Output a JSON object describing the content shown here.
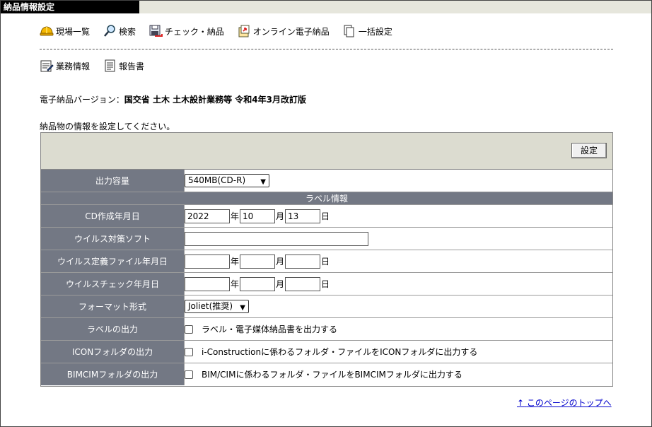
{
  "window": {
    "title": "納品情報設定"
  },
  "toolbar": {
    "row1": [
      {
        "label": "現場一覧",
        "icon": "helmet-icon"
      },
      {
        "label": "検索",
        "icon": "magnifier-icon"
      },
      {
        "label": "チェック・納品",
        "icon": "floppy-check-icon"
      },
      {
        "label": "オンライン電子納品",
        "icon": "online-delivery-icon"
      },
      {
        "label": "一括設定",
        "icon": "documents-icon"
      }
    ],
    "row2": [
      {
        "label": "業務情報",
        "icon": "business-info-icon"
      },
      {
        "label": "報告書",
        "icon": "report-icon"
      }
    ]
  },
  "version": {
    "prefix": "電子納品バージョン：",
    "value": "国交省 土木 土木設計業務等 令和4年3月改訂版"
  },
  "instruction": "納品物の情報を設定してください。",
  "form": {
    "set_button": "設定",
    "output_capacity": {
      "label": "出力容量",
      "value": "540MB(CD-R)"
    },
    "label_section": "ラベル情報",
    "cd_date": {
      "label": "CD作成年月日",
      "year": "2022",
      "month": "10",
      "day": "13"
    },
    "antivirus": {
      "label": "ウイルス対策ソフト",
      "value": ""
    },
    "virus_def_date": {
      "label": "ウイルス定義ファイル年月日",
      "year": "",
      "month": "",
      "day": ""
    },
    "virus_check_date": {
      "label": "ウイルスチェック年月日",
      "year": "",
      "month": "",
      "day": ""
    },
    "format": {
      "label": "フォーマット形式",
      "value": "Joliet(推奨)"
    },
    "label_output": {
      "label": "ラベルの出力",
      "checkbox": "ラベル・電子媒体納品書を出力する"
    },
    "icon_output": {
      "label": "ICONフォルダの出力",
      "checkbox": "i-Constructionに係わるフォルダ・ファイルをICONフォルダに出力する"
    },
    "bimcim_output": {
      "label": "BIMCIMフォルダの出力",
      "checkbox": "BIM/CIMに係わるフォルダ・ファイルをBIMCIMフォルダに出力する"
    },
    "units": {
      "year": "年",
      "month": "月",
      "day": "日"
    }
  },
  "footer": {
    "top_link": "このページのトップへ",
    "top_link_arrow": "↑"
  }
}
